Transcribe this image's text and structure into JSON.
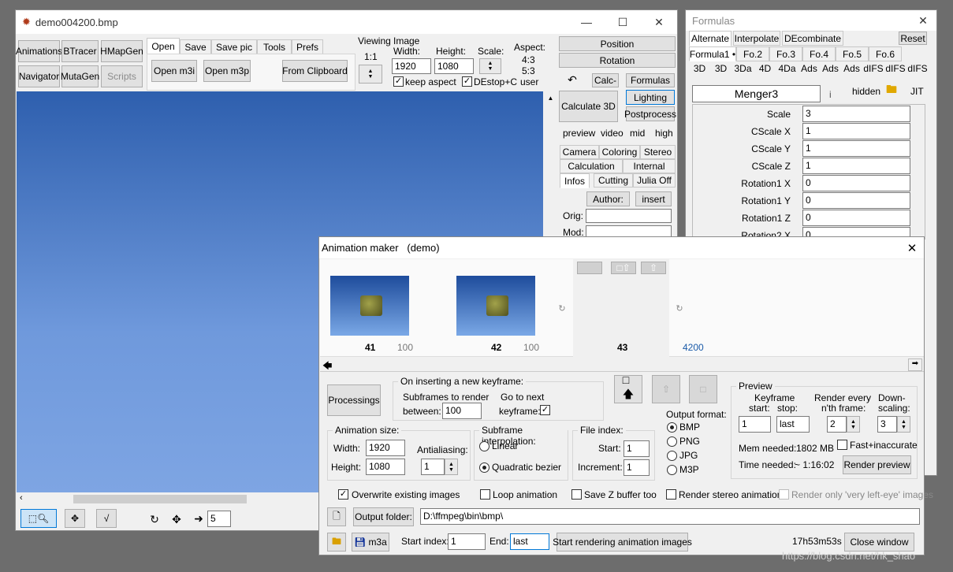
{
  "main": {
    "title": "demo004200.bmp",
    "left_buttons": [
      "Animations",
      "BTracer",
      "HMapGen",
      "Navigator",
      "MutaGen",
      "Scripts"
    ],
    "tabs": [
      "Open",
      "Save",
      "Save pic",
      "Tools",
      "Prefs"
    ],
    "open_m3i": "Open m3i",
    "open_m3p": "Open m3p",
    "from_clipboard": "From Clipboard",
    "viewing_label": "Viewing",
    "viewing_value": "1:1",
    "image_label": "Image",
    "width_label": "Width:",
    "height_label": "Height:",
    "scale_label": "Scale:",
    "width": "1920",
    "height": "1080",
    "aspect_label": "Aspect:",
    "aspect_1": "4:3",
    "aspect_2": "5:3",
    "aspect_3": "user",
    "keep_aspect": "keep aspect",
    "destop": "DEstop+C",
    "position": "Position",
    "rotation": "Rotation",
    "calc_minus": "Calc-",
    "formulas": "Formulas",
    "calculate_3d": "Calculate 3D",
    "lighting": "Lighting",
    "postprocess": "Postprocess",
    "quality": [
      "preview",
      "video",
      "mid",
      "high"
    ],
    "subtabs_row1": [
      "Camera",
      "Coloring",
      "Stereo"
    ],
    "subtabs_row2": [
      "Calculation",
      "Internal"
    ],
    "subtabs_row3": [
      "Infos",
      "Cutting",
      "Julia Off"
    ],
    "author_btn": "Author:",
    "insert_btn": "insert",
    "orig_label": "Orig:",
    "mod_label": "Mod:",
    "step_value": "5"
  },
  "formulas": {
    "title": "Formulas",
    "tabs": [
      "Alternate",
      "Interpolate",
      "DEcombinate"
    ],
    "reset": "Reset",
    "ftabs": [
      "Formula1 •",
      "Fo.2",
      "Fo.3",
      "Fo.4",
      "Fo.5",
      "Fo.6"
    ],
    "types": [
      "3D",
      "3D",
      "3Da",
      "4D",
      "4Da",
      "Ads",
      "Ads",
      "Ads",
      "dIFS",
      "dIFS",
      "dIFS"
    ],
    "formula_name": "Menger3",
    "info_icon": "i",
    "hidden": "hidden",
    "jit": "JIT",
    "params": [
      {
        "label": "Scale",
        "value": "3"
      },
      {
        "label": "CScale X",
        "value": "1"
      },
      {
        "label": "CScale Y",
        "value": "1"
      },
      {
        "label": "CScale Z",
        "value": "1"
      },
      {
        "label": "Rotation1 X",
        "value": "0"
      },
      {
        "label": "Rotation1 Y",
        "value": "0"
      },
      {
        "label": "Rotation1 Z",
        "value": "0"
      },
      {
        "label": "Rotation2 X",
        "value": "0"
      }
    ]
  },
  "anim": {
    "title": "Animation maker   (demo)",
    "frames": [
      {
        "num": "41",
        "sub": "100"
      },
      {
        "num": "42",
        "sub": "100"
      },
      {
        "num": "43",
        "sub": ""
      },
      {
        "num": "",
        "sub": "4200"
      }
    ],
    "processings": "Processings",
    "on_insert": "On inserting a new keyframe:",
    "subframes_to_render": "Subframes to render",
    "between": "between:",
    "between_value": "100",
    "go_to_next": "Go to next",
    "keyframe": "keyframe:",
    "preview_group": "Preview",
    "keyframe_lbl": "Keyframe",
    "start_lbl": "start:",
    "stop_lbl": "stop:",
    "render_every": "Render every",
    "nth_frame": "n'th frame:",
    "downscaling1": "Down-",
    "downscaling2": "scaling:",
    "kf_start": "1",
    "kf_stop": "last",
    "nth": "2",
    "down": "3",
    "mem_needed": "Mem needed:",
    "mem_value": "1802 MB",
    "fast_inaccurate": "Fast+inaccurate",
    "time_needed": "Time needed:",
    "time_value": "~ 1:16:02",
    "render_preview": "Render preview",
    "anim_size": "Animation size:",
    "width_lbl": "Width:",
    "height_lbl": "Height:",
    "width": "1920",
    "height": "1080",
    "antialiasing": "Antialiasing:",
    "aa_value": "1",
    "subframe_interp": "Subframe interpolation:",
    "linear": "Linear",
    "quadratic": "Quadratic bezier",
    "file_index": "File index:",
    "fi_start_lbl": "Start:",
    "fi_start": "1",
    "fi_inc_lbl": "Increment:",
    "fi_inc": "1",
    "output_format": "Output format:",
    "formats": [
      "BMP",
      "PNG",
      "JPG",
      "M3P"
    ],
    "overwrite": "Overwrite existing images",
    "loop": "Loop animation",
    "save_z": "Save Z buffer too",
    "render_stereo": "Render stereo animation",
    "render_left": "Render only 'very left-eye' images",
    "output_folder_btn": "Output folder:",
    "output_folder": "D:\\ffmpeg\\bin\\bmp\\",
    "m3a": "m3a",
    "start_index_lbl": "Start index:",
    "start_index": "1",
    "end_lbl": "End:",
    "end_value": "last",
    "start_rendering": "Start rendering animation images",
    "total_time": "17h53m53s",
    "close_window": "Close window"
  },
  "watermark": "https://blog.csdn.net/hk_shao"
}
